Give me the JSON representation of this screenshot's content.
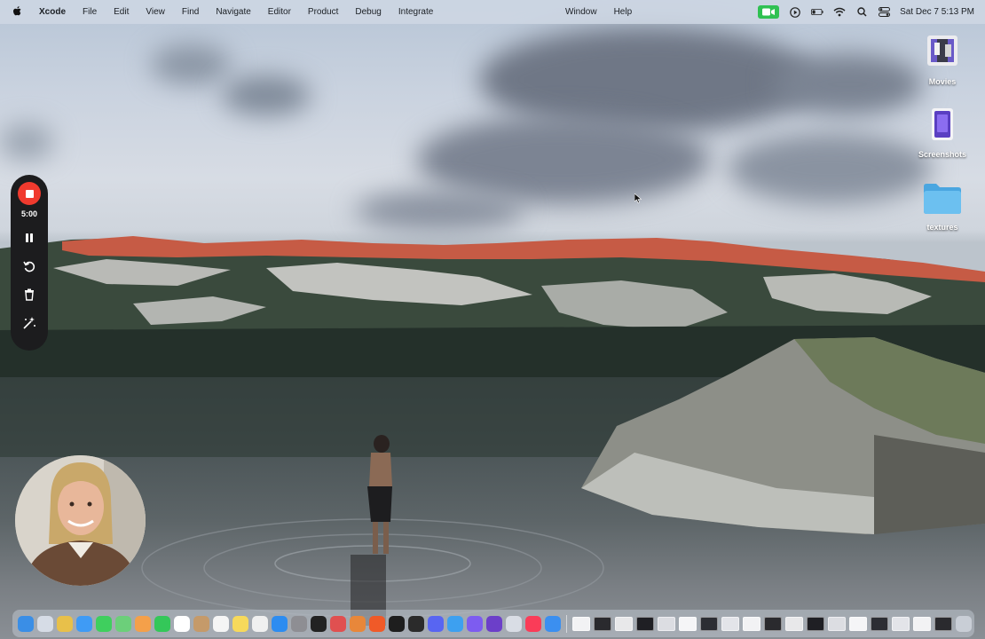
{
  "menubar": {
    "app_name": "Xcode",
    "menus": [
      "File",
      "Edit",
      "View",
      "Find",
      "Navigate",
      "Editor",
      "Product",
      "Debug",
      "Integrate"
    ],
    "menus_right": [
      "Window",
      "Help"
    ],
    "clock": "Sat Dec 7  5:13 PM",
    "icons": [
      "apple-icon",
      "facetime-icon",
      "play-icon",
      "battery-icon",
      "wifi-icon",
      "search-icon",
      "control-center-icon"
    ],
    "accent_color": "#2fc152"
  },
  "desktop_icons": [
    {
      "label": "Movies",
      "icon": "movies-thumbnail-icon"
    },
    {
      "label": "Screenshots",
      "icon": "screenshot-thumbnail-icon"
    },
    {
      "label": "textures",
      "icon": "folder-icon"
    }
  ],
  "recorder": {
    "timer": "5:00",
    "record_color": "#f03a2e",
    "tools": [
      "stop-icon",
      "pause-icon",
      "restart-icon",
      "trash-icon",
      "effects-icon"
    ]
  },
  "dock": {
    "apps": [
      {
        "name": "finder",
        "color": "#3a8ee6"
      },
      {
        "name": "launchpad",
        "color": "#d6dce6"
      },
      {
        "name": "chrome",
        "color": "#e8c04a"
      },
      {
        "name": "mail",
        "color": "#3f9bf5"
      },
      {
        "name": "messages",
        "color": "#3fcf5e"
      },
      {
        "name": "maps",
        "color": "#6ccf7a"
      },
      {
        "name": "photos",
        "color": "#f4a04a"
      },
      {
        "name": "facetime",
        "color": "#34c759"
      },
      {
        "name": "calendar",
        "color": "#ffffff"
      },
      {
        "name": "contacts",
        "color": "#c59a6a"
      },
      {
        "name": "reminders",
        "color": "#f5f5f5"
      },
      {
        "name": "notes",
        "color": "#f7d95b"
      },
      {
        "name": "freeform",
        "color": "#f0f0f0"
      },
      {
        "name": "app-store",
        "color": "#2d8cf0"
      },
      {
        "name": "system-settings",
        "color": "#8e8e93"
      },
      {
        "name": "stickies",
        "color": "#222222"
      },
      {
        "name": "games",
        "color": "#e05050"
      },
      {
        "name": "blender",
        "color": "#e8873a"
      },
      {
        "name": "brave",
        "color": "#f05a28"
      },
      {
        "name": "figma",
        "color": "#1e1e1e"
      },
      {
        "name": "terminal",
        "color": "#2b2b2b"
      },
      {
        "name": "discord",
        "color": "#5865f2"
      },
      {
        "name": "xcode-cloud",
        "color": "#3da0f0"
      },
      {
        "name": "reality-composer",
        "color": "#7d5cf0"
      },
      {
        "name": "obsidian",
        "color": "#6c3fc9"
      },
      {
        "name": "preview",
        "color": "#d9dde5"
      },
      {
        "name": "music",
        "color": "#fa3c58"
      },
      {
        "name": "xcode",
        "color": "#3b8ff0"
      }
    ],
    "windows": 18
  }
}
